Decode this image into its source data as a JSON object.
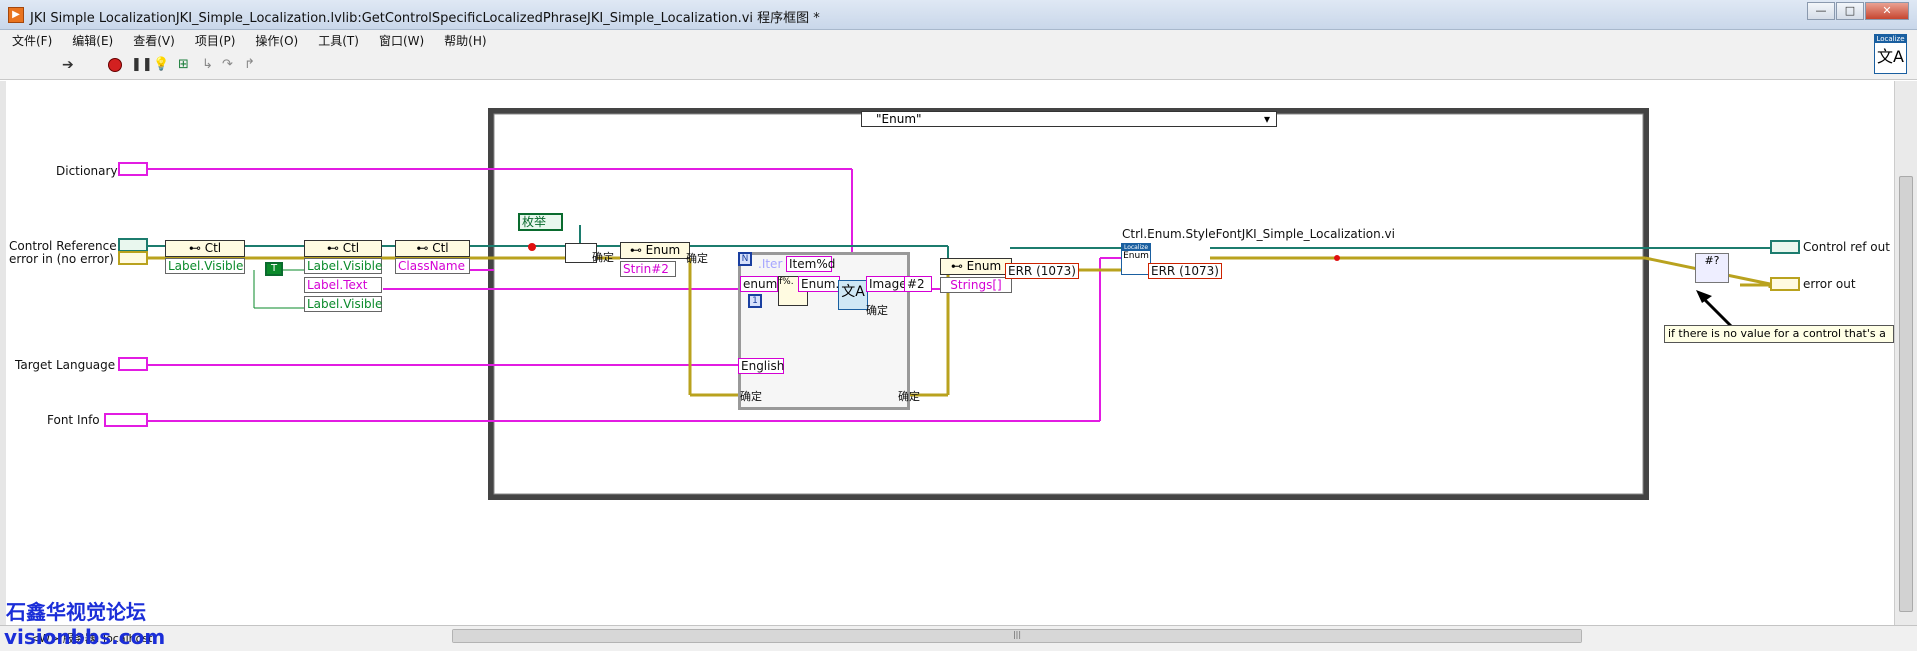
{
  "window": {
    "title": "JKI Simple LocalizationJKI_Simple_Localization.lvlib:GetControlSpecificLocalizedPhraseJKI_Simple_Localization.vi 程序框图 *",
    "controls": [
      "—",
      "□",
      "✕"
    ]
  },
  "menu": [
    "文件(F)",
    "编辑(E)",
    "查看(V)",
    "项目(P)",
    "操作(O)",
    "工具(T)",
    "窗口(W)",
    "帮助(H)"
  ],
  "toolbar": {
    "run_icon": "run-arrow-icon",
    "abort_icon": "abort-icon",
    "pause_icon": "pause-icon",
    "highlight_icon": "highlight-execution-icon",
    "retain_icon": "retain-wire-values-icon",
    "step_into_icon": "step-into-icon",
    "step_over_icon": "step-over-icon",
    "step_out_icon": "step-out-icon"
  },
  "front_labels": {
    "dictionary": "Dictionary",
    "control_reference": "Control Reference",
    "error_in": "error in (no error)",
    "target_language": "Target Language",
    "font_info": "Font Info",
    "control_ref_out": "Control ref out",
    "error_out": "error out"
  },
  "case_structure": {
    "selector": "\"Enum\""
  },
  "nodes": {
    "ctl1": "Ctl",
    "ctl1_prop": "Label.Visible",
    "ctl2": "Ctl",
    "ctl2_props": [
      "Label.Visible",
      "Label.Text",
      "Label.Visible"
    ],
    "ctl3": "Ctl",
    "ctl3_prop": "ClassName",
    "enum_node1": "Enum",
    "enum_node1_prop": "Strin#2",
    "enum_node2": "Enum",
    "enum_node2_prop": "Strings[]",
    "const_true": "T",
    "const_enum": "枚举",
    "const_confirm": "确定",
    "loop_iter_label": ".Iter",
    "loop_format": "Item%d",
    "loop_enum_label": "enum",
    "loop_enum2_label": "Enum.",
    "loop_image_label": "Image",
    "loop_hash2": "#2",
    "loop_index": "1",
    "loop_count": "N",
    "english_const": "English",
    "err1": "ERR (1073)",
    "err2": "ERR (1073)",
    "subvi_label": "Ctrl.Enum.StyleFontJKI_Simple_Localization.vi",
    "subvi_text": "Enum"
  },
  "tooltip": "if there is no value for a control that's a",
  "status": {
    "context": "<W>   服务器: localhost"
  },
  "watermark": {
    "line1": "石鑫华视觉论坛",
    "line2": "visionbbs.com"
  },
  "colors": {
    "string_wire": "#e21ce2",
    "error_wire": "#c9b21e",
    "ref_wire": "#1c7c6e",
    "bool_wire": "#0a8a2a"
  }
}
